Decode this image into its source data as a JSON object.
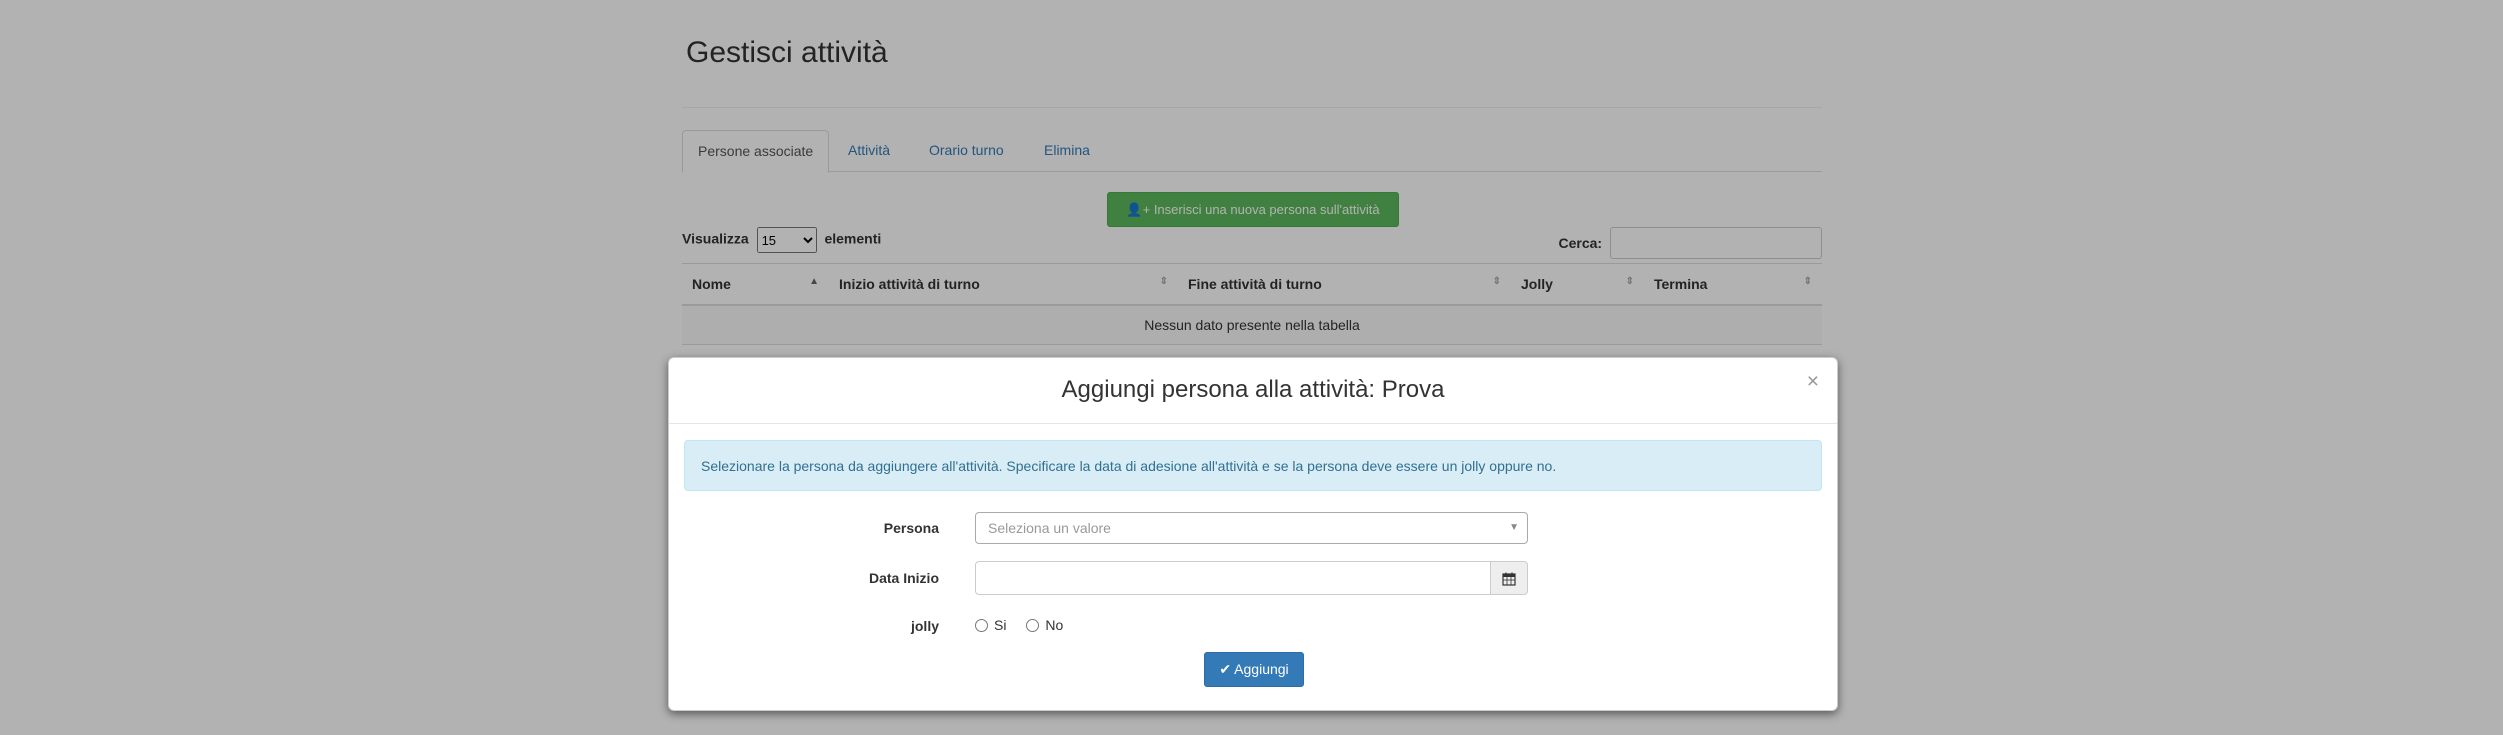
{
  "page": {
    "title": "Gestisci attività",
    "tabs": [
      {
        "label": "Persone associate",
        "active": true
      },
      {
        "label": "Attività"
      },
      {
        "label": "Orario turno"
      },
      {
        "label": "Elimina"
      }
    ],
    "add_person_button": "Inserisci una nuova persona sull'attività",
    "length": {
      "prefix": "Visualizza",
      "value": "15",
      "suffix": "elementi"
    },
    "search_label": "Cerca:",
    "table": {
      "columns": [
        "Nome",
        "Inizio attività di turno",
        "Fine attività di turno",
        "Jolly",
        "Termina"
      ],
      "empty_message": "Nessun dato presente nella tabella"
    }
  },
  "modal": {
    "title": "Aggiungi persona alla attività: Prova",
    "close": "×",
    "alert": "Selezionare la persona da aggiungere all'attività. Specificare la data di adesione all'attività e se la persona deve essere un jolly oppure no.",
    "persona_label": "Persona",
    "persona_placeholder": "Seleziona un valore",
    "data_label": "Data Inizio",
    "jolly_label": "jolly",
    "radio_si": "Si",
    "radio_no": "No",
    "submit": "Aggiungi"
  }
}
